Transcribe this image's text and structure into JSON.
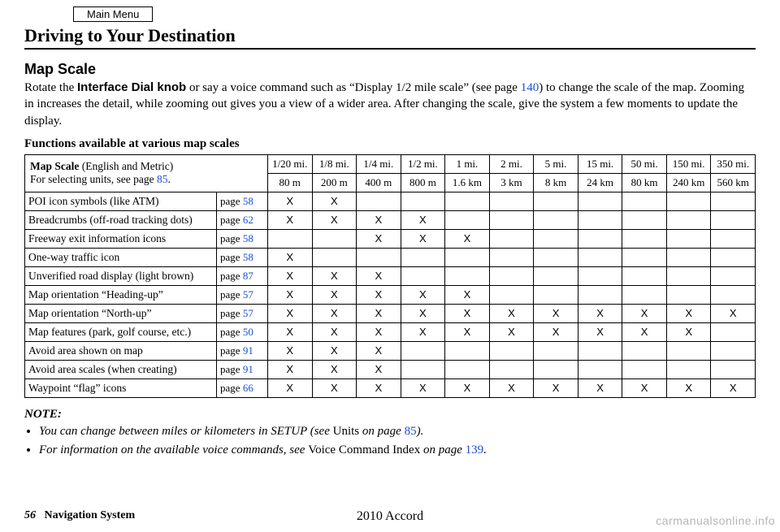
{
  "menu_button": "Main Menu",
  "title": "Driving to Your Destination",
  "section": "Map Scale",
  "intro": {
    "pre": "Rotate the ",
    "knob": "Interface Dial knob",
    "mid": " or say a voice command such as “Display 1/2 mile scale” (see page ",
    "page_ref": "140",
    "post": ") to change the scale of the map. Zooming in increases the detail, while zooming out gives you a view of a wider area. After changing the scale, give the system a few moments to update the display."
  },
  "table_caption": "Functions available at various map scales",
  "header": {
    "label_line1_a": "Map Scale",
    "label_line1_b": " (English and Metric)",
    "label_line2_a": "For selecting units, see page ",
    "label_line2_ref": "85",
    "label_line2_b": ".",
    "scales_en": [
      "1/20 mi.",
      "1/8 mi.",
      "1/4 mi.",
      "1/2 mi.",
      "1 mi.",
      "2 mi.",
      "5 mi.",
      "15 mi.",
      "50 mi.",
      "150 mi.",
      "350 mi."
    ],
    "scales_m": [
      "80 m",
      "200 m",
      "400 m",
      "800 m",
      "1.6 km",
      "3 km",
      "8 km",
      "24 km",
      "80 km",
      "240 km",
      "560 km"
    ]
  },
  "page_label": "page ",
  "rows": [
    {
      "label": "POI icon symbols (like ATM)",
      "page": "58",
      "x": [
        "X",
        "X",
        "",
        "",
        "",
        "",
        "",
        "",
        "",
        "",
        ""
      ]
    },
    {
      "label": "Breadcrumbs (off-road tracking dots)",
      "page": "62",
      "x": [
        "X",
        "X",
        "X",
        "X",
        "",
        "",
        "",
        "",
        "",
        "",
        ""
      ]
    },
    {
      "label": "Freeway exit information icons",
      "page": "58",
      "x": [
        "",
        "",
        "X",
        "X",
        "X",
        "",
        "",
        "",
        "",
        "",
        ""
      ]
    },
    {
      "label": "One-way traffic icon",
      "page": "58",
      "x": [
        "X",
        "",
        "",
        "",
        "",
        "",
        "",
        "",
        "",
        "",
        ""
      ]
    },
    {
      "label": "Unverified road display (light brown)",
      "page": "87",
      "x": [
        "X",
        "X",
        "X",
        "",
        "",
        "",
        "",
        "",
        "",
        "",
        ""
      ]
    },
    {
      "label": "Map orientation “Heading-up”",
      "page": "57",
      "x": [
        "X",
        "X",
        "X",
        "X",
        "X",
        "",
        "",
        "",
        "",
        "",
        ""
      ]
    },
    {
      "label": "Map orientation “North-up”",
      "page": "57",
      "x": [
        "X",
        "X",
        "X",
        "X",
        "X",
        "X",
        "X",
        "X",
        "X",
        "X",
        "X"
      ]
    },
    {
      "label": "Map features (park, golf course, etc.)",
      "page": "50",
      "x": [
        "X",
        "X",
        "X",
        "X",
        "X",
        "X",
        "X",
        "X",
        "X",
        "X",
        ""
      ]
    },
    {
      "label": "Avoid area shown on map",
      "page": "91",
      "x": [
        "X",
        "X",
        "X",
        "",
        "",
        "",
        "",
        "",
        "",
        "",
        ""
      ]
    },
    {
      "label": "Avoid area scales (when creating)",
      "page": "91",
      "x": [
        "X",
        "X",
        "X",
        "",
        "",
        "",
        "",
        "",
        "",
        "",
        ""
      ]
    },
    {
      "label": "Waypoint “flag” icons",
      "page": "66",
      "x": [
        "X",
        "X",
        "X",
        "X",
        "X",
        "X",
        "X",
        "X",
        "X",
        "X",
        "X"
      ]
    }
  ],
  "note_heading": "NOTE:",
  "notes": [
    {
      "pre": "You can change between miles or kilometers in SETUP (see ",
      "roman": "Units",
      "mid": " on page ",
      "ref": "85",
      "post": ")."
    },
    {
      "pre": "For information on the available voice commands, see ",
      "roman": "Voice Command Index",
      "mid": " on page ",
      "ref": "139",
      "post": "."
    }
  ],
  "footer": {
    "page": "56",
    "label": "Navigation System",
    "model": "2010 Accord"
  },
  "watermark": "carmanualsonline.info"
}
